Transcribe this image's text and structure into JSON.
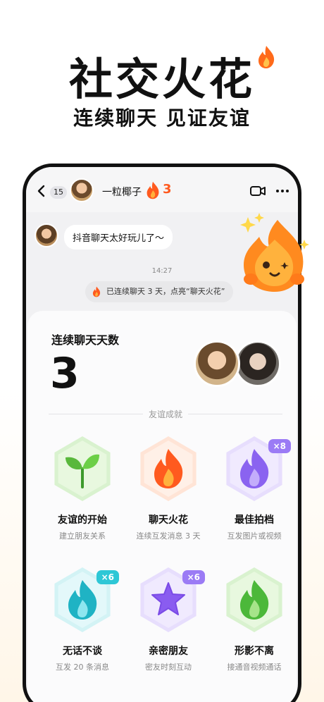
{
  "hero": {
    "title": "社交火花",
    "subtitle": "连续聊天 见证友谊"
  },
  "chat_header": {
    "unread_count": "15",
    "contact_name": "一粒椰子",
    "streak_days": "3"
  },
  "messages": [
    {
      "text": "抖音聊天太好玩儿了～"
    }
  ],
  "time_stamp": "14:27",
  "system_notice": "已连续聊天 3 天，点亮“聊天火花”",
  "streak_card": {
    "title": "连续聊天天数",
    "days": "3",
    "section_label": "友谊成就"
  },
  "achievements": [
    {
      "title": "友谊的开始",
      "desc": "建立朋友关系",
      "multiplier": "",
      "icon": "sprout-icon"
    },
    {
      "title": "聊天火花",
      "desc": "连续互发消息 3 天",
      "multiplier": "",
      "icon": "flame-icon"
    },
    {
      "title": "最佳拍档",
      "desc": "互发图片或视频",
      "multiplier": "×8",
      "icon": "purple-flame-icon"
    },
    {
      "title": "无话不谈",
      "desc": "互发 20 条消息",
      "multiplier": "×6",
      "icon": "water-drop-icon"
    },
    {
      "title": "亲密朋友",
      "desc": "密友时刻互动",
      "multiplier": "×6",
      "icon": "star-icon"
    },
    {
      "title": "形影不离",
      "desc": "接通音视频通话",
      "multiplier": "",
      "icon": "green-flame-icon"
    }
  ],
  "colors": {
    "accent_orange": "#ff5a1f",
    "badge_purple": "#9b7bf5",
    "badge_teal": "#2ec7d6"
  }
}
